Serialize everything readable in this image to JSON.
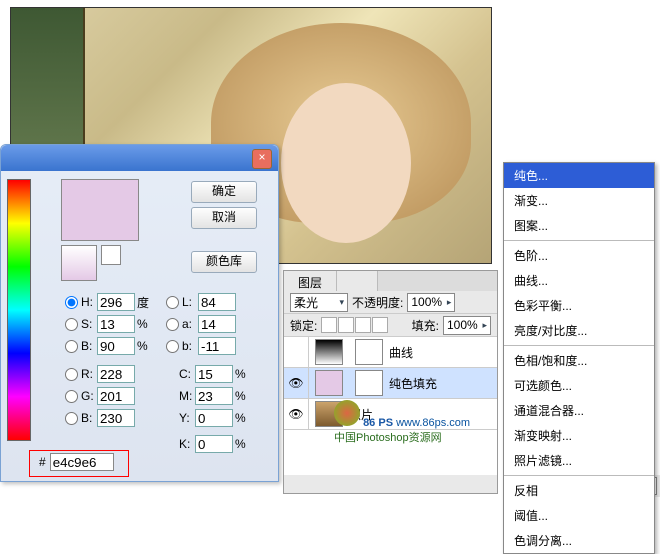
{
  "color_picker": {
    "close_icon": "×",
    "ok": "确定",
    "cancel": "取消",
    "library": "颜色库",
    "H": {
      "label": "H:",
      "value": "296",
      "unit": "度"
    },
    "S": {
      "label": "S:",
      "value": "13",
      "unit": "%"
    },
    "Bv": {
      "label": "B:",
      "value": "90",
      "unit": "%"
    },
    "R": {
      "label": "R:",
      "value": "228"
    },
    "G": {
      "label": "G:",
      "value": "201"
    },
    "B": {
      "label": "B:",
      "value": "230"
    },
    "L": {
      "label": "L:",
      "value": "84"
    },
    "a": {
      "label": "a:",
      "value": "14"
    },
    "b": {
      "label": "b:",
      "value": "-11"
    },
    "C": {
      "label": "C:",
      "value": "15",
      "unit": "%"
    },
    "M": {
      "label": "M:",
      "value": "23",
      "unit": "%"
    },
    "Y": {
      "label": "Y:",
      "value": "0",
      "unit": "%"
    },
    "K": {
      "label": "K:",
      "value": "0",
      "unit": "%"
    },
    "hex_label": "#",
    "hex": "e4c9e6",
    "swatch_color": "#e4c9e6"
  },
  "layers": {
    "title_tab": "图层",
    "blend_mode": "柔光",
    "opacity_label": "不透明度:",
    "opacity": "100%",
    "lock_label": "锁定:",
    "fill_label": "填充:",
    "fill": "100%",
    "items": [
      {
        "name": "曲线",
        "eye": false
      },
      {
        "name": "纯色填充",
        "eye": true,
        "selected": true
      },
      {
        "name": "照片",
        "eye": true
      }
    ]
  },
  "menu": {
    "items": [
      "纯色...",
      "渐变...",
      "图案...",
      "-",
      "色阶...",
      "曲线...",
      "色彩平衡...",
      "亮度/对比度...",
      "-",
      "色相/饱和度...",
      "可选颜色...",
      "通道混合器...",
      "渐变映射...",
      "照片滤镜...",
      "-",
      "反相",
      "阈值...",
      "色调分离..."
    ],
    "selected_index": 0
  },
  "watermark": {
    "text": "中国Photoshop资源网",
    "url": "www.86ps.com",
    "brand": "86 PS"
  }
}
